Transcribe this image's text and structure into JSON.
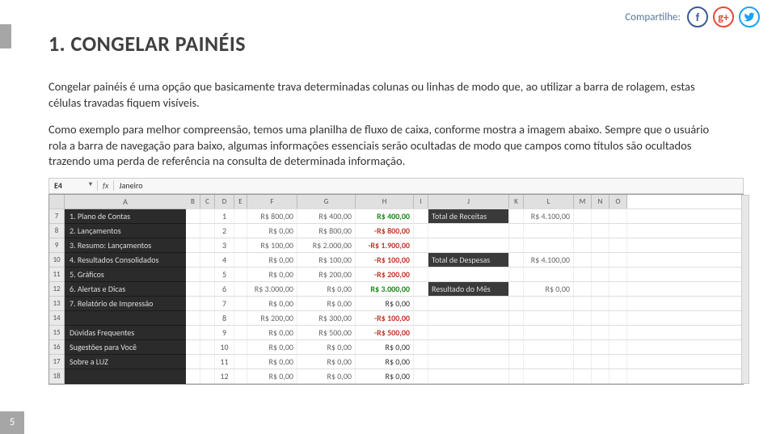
{
  "share": {
    "label": "Compartilhe:"
  },
  "heading": "1. CONGELAR PAINÉIS",
  "para1": "Congelar painéis é uma opção que basicamente trava determinadas colunas ou linhas de modo que, ao utilizar a barra de rolagem, estas células travadas fiquem visíveis.",
  "para2": "Como exemplo para melhor compreensão, temos uma planilha de fluxo de caixa, conforme mostra a imagem abaixo. Sempre que o usuário rola a barra de navegação para baixo, algumas informações essenciais serão ocultadas de modo que campos como títulos são ocultados trazendo uma perda de referência na consulta de determinada informação.",
  "sheet": {
    "nameBox": "E4",
    "fx": "fx",
    "fxVal": "Janeiro",
    "colHdrs": {
      "A": "A",
      "B": "B",
      "C": "C",
      "D": "D",
      "E": "E",
      "F": "F",
      "G": "G",
      "H": "H",
      "I": "I",
      "J": "J",
      "K": "K",
      "L": "L",
      "M": "M",
      "N": "N",
      "O": "O"
    },
    "rowNums": [
      "7",
      "8",
      "9",
      "10",
      "11",
      "12",
      "13",
      "14",
      "15",
      "16",
      "17",
      "18"
    ],
    "menu": [
      "1. Plano de Contas",
      "2. Lançamentos",
      "3. Resumo: Lançamentos",
      "4. Resultados Consolidados",
      "5. Gráficos",
      "6. Alertas e Dicas",
      "7. Relatório de Impressão",
      "",
      "Dúvidas Frequentes",
      "Sugestões para Você",
      "Sobre a LUZ",
      ""
    ],
    "side": {
      "receitas": "Total de Receitas",
      "despesas": "Total de Despesas",
      "resultado": "Resultado do Mês",
      "vReceitas": "R$ 4.100,00",
      "vDespesas": "R$ 4.100,00",
      "vResultado": "R$ 0,00"
    },
    "rows": [
      {
        "d": "1",
        "f": "R$ 800,00",
        "g": "R$ 400,00",
        "h": "R$ 400,00",
        "hc": "hgreen"
      },
      {
        "d": "2",
        "f": "R$ 0,00",
        "g": "R$ 800,00",
        "h": "-R$ 800,00",
        "hc": "hred"
      },
      {
        "d": "3",
        "f": "R$ 100,00",
        "g": "R$ 2.000,00",
        "h": "-R$ 1.900,00",
        "hc": "hred"
      },
      {
        "d": "4",
        "f": "R$ 0,00",
        "g": "R$ 100,00",
        "h": "-R$ 100,00",
        "hc": "hred"
      },
      {
        "d": "5",
        "f": "R$ 0,00",
        "g": "R$ 200,00",
        "h": "-R$ 200,00",
        "hc": "hred"
      },
      {
        "d": "6",
        "f": "R$ 3.000,00",
        "g": "R$ 0,00",
        "h": "R$ 3.000,00",
        "hc": "hgreen"
      },
      {
        "d": "7",
        "f": "R$ 0,00",
        "g": "R$ 0,00",
        "h": "R$ 0,00",
        "hc": ""
      },
      {
        "d": "8",
        "f": "R$ 200,00",
        "g": "R$ 300,00",
        "h": "-R$ 100,00",
        "hc": "hred"
      },
      {
        "d": "9",
        "f": "R$ 0,00",
        "g": "R$ 500,00",
        "h": "-R$ 500,00",
        "hc": "hred"
      },
      {
        "d": "10",
        "f": "R$ 0,00",
        "g": "R$ 0,00",
        "h": "R$ 0,00",
        "hc": ""
      },
      {
        "d": "11",
        "f": "R$ 0,00",
        "g": "R$ 0,00",
        "h": "R$ 0,00",
        "hc": ""
      },
      {
        "d": "12",
        "f": "R$ 0,00",
        "g": "R$ 0,00",
        "h": "R$ 0,00",
        "hc": ""
      }
    ]
  },
  "pageNum": "5"
}
